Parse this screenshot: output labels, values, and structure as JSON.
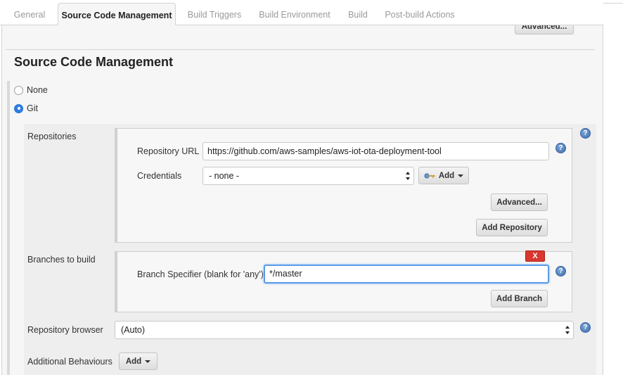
{
  "tabs": [
    {
      "label": "General",
      "active": false
    },
    {
      "label": "Source Code Management",
      "active": true
    },
    {
      "label": "Build Triggers",
      "active": false
    },
    {
      "label": "Build Environment",
      "active": false
    },
    {
      "label": "Build",
      "active": false
    },
    {
      "label": "Post-build Actions",
      "active": false
    }
  ],
  "top_advanced_button": "Advanced...",
  "section_title": "Source Code Management",
  "scm_options": [
    {
      "label": "None",
      "selected": false
    },
    {
      "label": "Git",
      "selected": true
    }
  ],
  "repositories": {
    "label": "Repositories",
    "url_label": "Repository URL",
    "url_value": "https://github.com/aws-samples/aws-iot-ota-deployment-tool",
    "credentials_label": "Credentials",
    "credentials_value": "- none -",
    "add_button": "Add",
    "advanced_button": "Advanced...",
    "add_repository_button": "Add Repository"
  },
  "branches": {
    "label": "Branches to build",
    "delete_button": "X",
    "specifier_label": "Branch Specifier (blank for 'any')",
    "specifier_value": "*/master",
    "add_branch_button": "Add Branch"
  },
  "repository_browser": {
    "label": "Repository browser",
    "value": "(Auto)"
  },
  "additional_behaviours": {
    "label": "Additional Behaviours",
    "add_button": "Add"
  },
  "help_icon_text": "?",
  "colors": {
    "accent_blue": "#2f7de1",
    "delete_red": "#d9382f",
    "panel_bg": "#f6f6f6"
  }
}
